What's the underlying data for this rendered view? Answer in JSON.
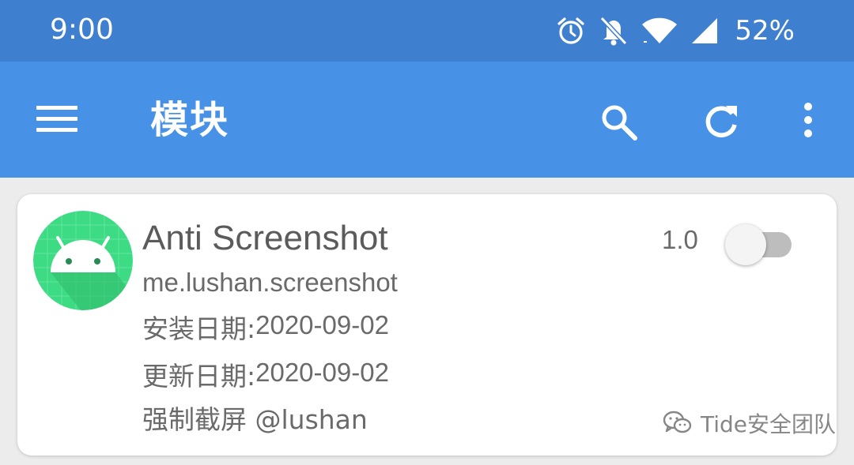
{
  "status_bar": {
    "time": "9:00",
    "battery": "52%",
    "icons": [
      "alarm-icon",
      "notifications-off-icon",
      "wifi-icon",
      "cell-signal-icon"
    ]
  },
  "app_bar": {
    "title": "模块",
    "icons": [
      "menu-icon",
      "search-icon",
      "refresh-icon",
      "more-vert-icon"
    ]
  },
  "module": {
    "name": "Anti Screenshot",
    "package": "me.lushan.screenshot",
    "install_label": "安装日期:",
    "install_date": "2020-09-02",
    "update_label": "更新日期:",
    "update_date": "2020-09-02",
    "description": "强制截屏 @lushan",
    "version": "1.0",
    "enabled": false,
    "icon": "android-icon"
  },
  "watermark": {
    "text": "Tide安全团队",
    "icon": "wechat-icon"
  },
  "colors": {
    "status_bar": "#3f7fcf",
    "app_bar": "#4792e6",
    "background": "#ececec",
    "card": "#ffffff",
    "app_icon": "#3ddc84"
  }
}
